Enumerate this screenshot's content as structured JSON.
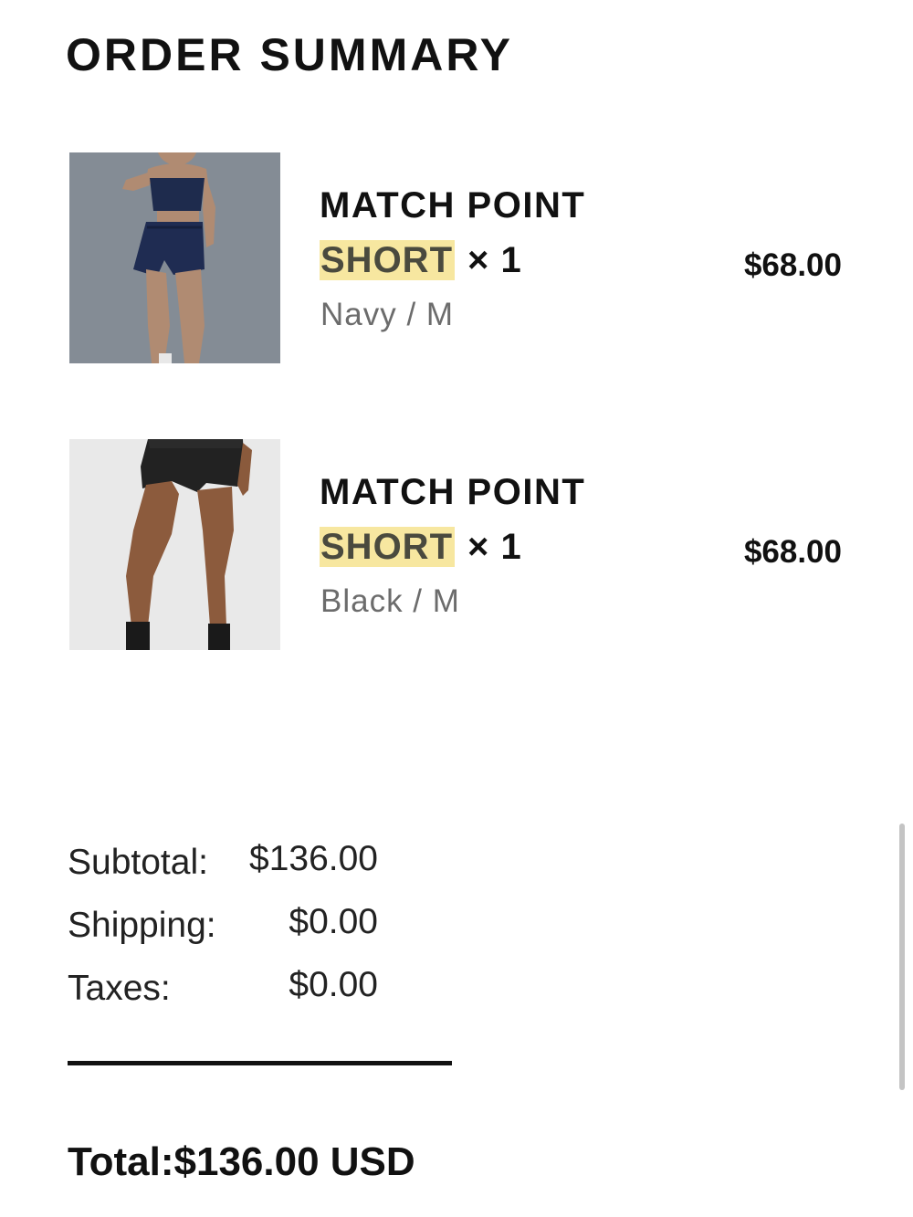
{
  "page": {
    "title": "ORDER SUMMARY"
  },
  "items": [
    {
      "name": "MATCH POINT",
      "name_highlight": "SHORT",
      "quantity": "× 1",
      "variant": "Navy / M",
      "price": "$68.00",
      "image": "product-photo-navy-short"
    },
    {
      "name": "MATCH POINT",
      "name_highlight": "SHORT",
      "quantity": "× 1",
      "variant": "Black / M",
      "price": "$68.00",
      "image": "product-photo-black-short"
    }
  ],
  "summary": {
    "subtotal_label": "Subtotal:",
    "subtotal_value": "$136.00",
    "shipping_label": "Shipping:",
    "shipping_value": "$0.00",
    "taxes_label": "Taxes:",
    "taxes_value": "$0.00",
    "total_label": "Total:",
    "total_value": "$136.00 USD"
  },
  "colors": {
    "highlight": "#f7e7a0",
    "text": "#111111",
    "muted": "#6c6c6c"
  }
}
